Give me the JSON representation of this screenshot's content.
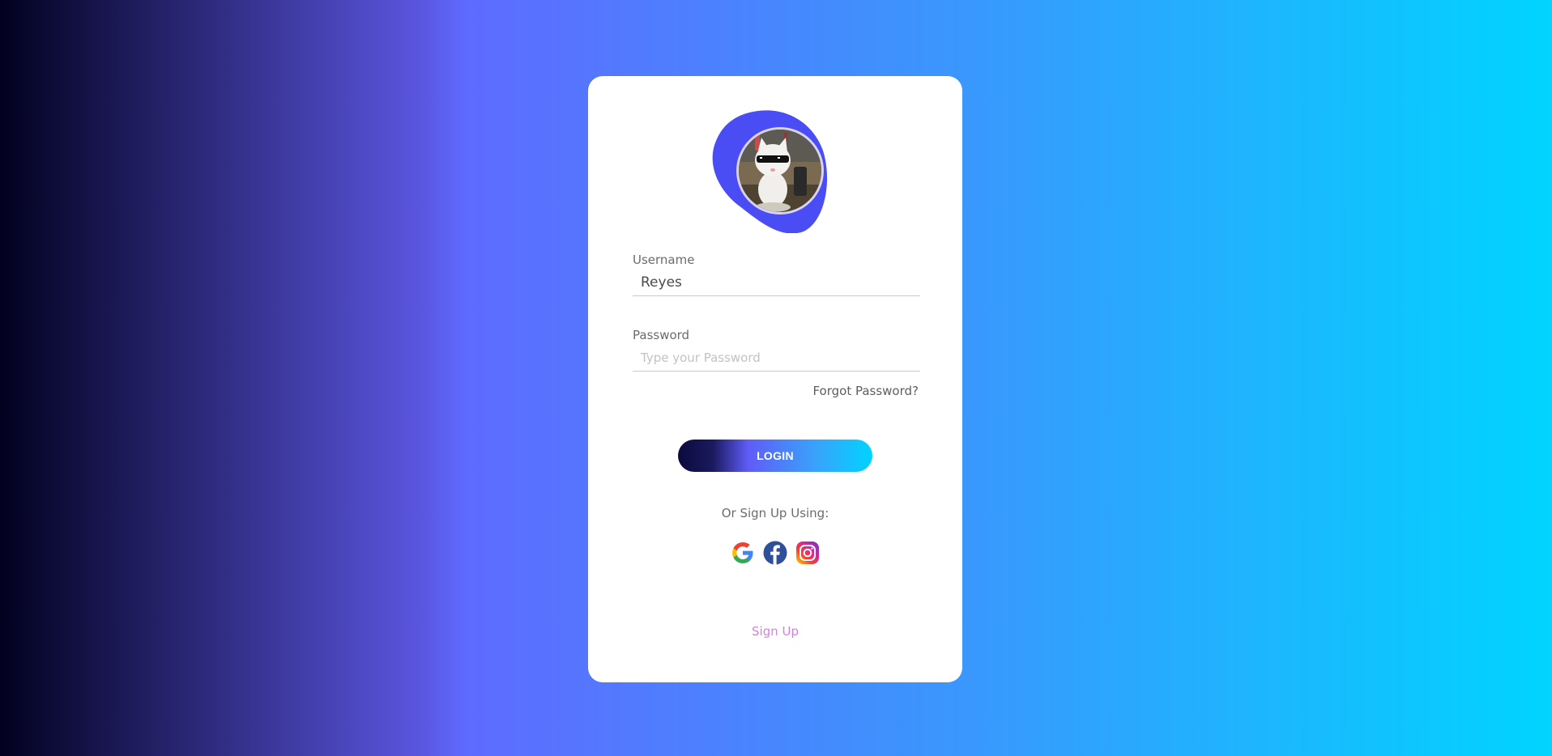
{
  "form": {
    "username_label": "Username",
    "username_value": "Reyes",
    "password_label": "Password",
    "password_placeholder": "Type your Password",
    "forgot_password": "Forgot Password?",
    "login_button": "LOGIN",
    "alt_signup_text": "Or Sign Up Using:",
    "signup_link": "Sign Up"
  },
  "social": [
    {
      "icon": "google-icon"
    },
    {
      "icon": "facebook-icon"
    },
    {
      "icon": "instagram-icon"
    }
  ],
  "colors": {
    "blob": "#4a4cf4",
    "signup_link": "#d580e0",
    "facebook": "#2f4f9a"
  }
}
